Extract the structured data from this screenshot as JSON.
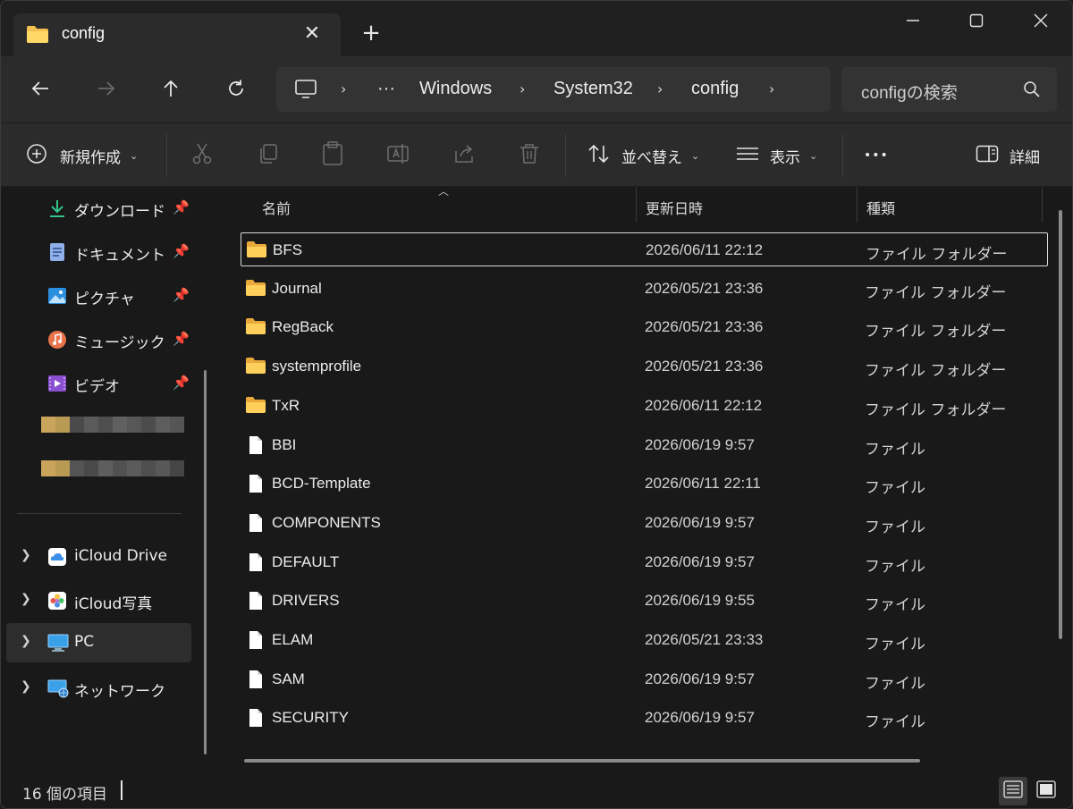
{
  "tab": {
    "title": "config",
    "close_glyph": "✕",
    "new_tab_glyph": "+"
  },
  "window_controls": [
    "minimize-icon",
    "maximize-icon",
    "close-icon"
  ],
  "address": {
    "overflow_glyph": "···",
    "crumbs": [
      "Windows",
      "System32",
      "config"
    ],
    "separator": "›"
  },
  "search": {
    "placeholder": "configの検索"
  },
  "toolbar": {
    "new_label": "新規作成",
    "sort_label": "並べ替え",
    "view_label": "表示",
    "more_glyph": "•••",
    "details_label": "詳細"
  },
  "sidebar": {
    "quick_access": [
      {
        "label": "ダウンロード",
        "icon": "download-icon",
        "pinned": true
      },
      {
        "label": "ドキュメント",
        "icon": "documents-icon",
        "pinned": true
      },
      {
        "label": "ピクチャ",
        "icon": "pictures-icon",
        "pinned": true
      },
      {
        "label": "ミュージック",
        "icon": "music-icon",
        "pinned": true
      },
      {
        "label": "ビデオ",
        "icon": "videos-icon",
        "pinned": true
      }
    ],
    "locations": [
      {
        "label": "iCloud Drive",
        "icon": "icloud-drive-icon"
      },
      {
        "label": "iCloud写真",
        "icon": "icloud-photos-icon"
      },
      {
        "label": "PC",
        "icon": "pc-icon",
        "selected": true
      },
      {
        "label": "ネットワーク",
        "icon": "network-icon"
      }
    ]
  },
  "columns": {
    "name": "名前",
    "date": "更新日時",
    "type": "種類"
  },
  "files": [
    {
      "name": "BFS",
      "date": "2026/06/11 22:12",
      "type": "ファイル フォルダー",
      "kind": "folder"
    },
    {
      "name": "Journal",
      "date": "2026/05/21 23:36",
      "type": "ファイル フォルダー",
      "kind": "folder"
    },
    {
      "name": "RegBack",
      "date": "2026/05/21 23:36",
      "type": "ファイル フォルダー",
      "kind": "folder"
    },
    {
      "name": "systemprofile",
      "date": "2026/05/21 23:36",
      "type": "ファイル フォルダー",
      "kind": "folder"
    },
    {
      "name": "TxR",
      "date": "2026/06/11 22:12",
      "type": "ファイル フォルダー",
      "kind": "folder"
    },
    {
      "name": "BBI",
      "date": "2026/06/19 9:57",
      "type": "ファイル",
      "kind": "file"
    },
    {
      "name": "BCD-Template",
      "date": "2026/06/11 22:11",
      "type": "ファイル",
      "kind": "file"
    },
    {
      "name": "COMPONENTS",
      "date": "2026/06/19 9:57",
      "type": "ファイル",
      "kind": "file"
    },
    {
      "name": "DEFAULT",
      "date": "2026/06/19 9:57",
      "type": "ファイル",
      "kind": "file"
    },
    {
      "name": "DRIVERS",
      "date": "2026/06/19 9:55",
      "type": "ファイル",
      "kind": "file"
    },
    {
      "name": "ELAM",
      "date": "2026/05/21 23:33",
      "type": "ファイル",
      "kind": "file"
    },
    {
      "name": "SAM",
      "date": "2026/06/19 9:57",
      "type": "ファイル",
      "kind": "file"
    },
    {
      "name": "SECURITY",
      "date": "2026/06/19 9:57",
      "type": "ファイル",
      "kind": "file"
    }
  ],
  "status": {
    "item_count": "16 個の項目"
  },
  "colors": {
    "folder": "#f4c04e",
    "accent": "#4cc2ff",
    "text": "#ececec"
  }
}
